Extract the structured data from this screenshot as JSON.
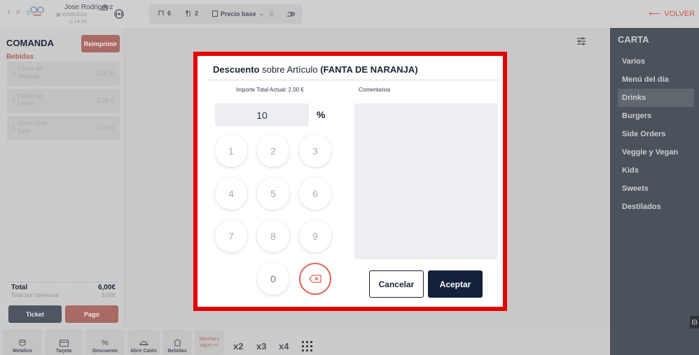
{
  "colors": {
    "accent": "#c65a4a",
    "modal_frame": "#e40000",
    "primary_dark": "#15203a",
    "sidebar_bg": "#4c525b"
  },
  "header": {
    "logo_text": "T·P·S·I",
    "user_name": "Jose Rodriguez",
    "date": "01/08/2025",
    "time": "14:24",
    "table_count": "6",
    "diners_count": "2",
    "price_mode": "Precio base",
    "back_label": "VOLVER"
  },
  "order": {
    "title": "COMANDA",
    "reprint_label": "Reimprimir",
    "category": "Bebidas",
    "items": [
      {
        "qty": "1",
        "name": "Fanta de Naranja",
        "price": "2,00 €"
      },
      {
        "qty": "1",
        "name": "Fanta de Limón",
        "price": "2,00 €"
      },
      {
        "qty": "1",
        "name": "Coca-Cola Zero",
        "price": "2,00 €"
      }
    ],
    "total_label": "Total",
    "total_value": "6,00€",
    "per_diner_label": "Total por comensal",
    "per_diner_value": "3,00€",
    "ticket_label": "Ticket",
    "pay_label": "Pago"
  },
  "toolbar": {
    "cash": "Metalico",
    "card": "Tarjeta",
    "discount": "Descuento",
    "open_drawer": "Abrir Caión",
    "drinks": "Bebidas",
    "march_line1": "Marcha y",
    "march_line2": "sigue >>",
    "x2": "x2",
    "x3": "x3",
    "x4": "x4"
  },
  "menu": {
    "title": "CARTA",
    "items": [
      "Varios",
      "Menú del día",
      "Drinks",
      "Burgers",
      "Side Orders",
      "Veggie y Vegan",
      "Kids",
      "Sweets",
      "Destilados"
    ],
    "active": "Drinks"
  },
  "modal": {
    "title_bold": "Descuento",
    "title_middle": "sobre Artículo",
    "title_item": "(FANTA DE NARANJA)",
    "current_total": "Importe Total Actual: 2,00 €",
    "comments_label": "Comentarios",
    "value": "10",
    "unit": "%",
    "keys": [
      "1",
      "2",
      "3",
      "4",
      "5",
      "6",
      "7",
      "8",
      "9",
      "0"
    ],
    "cancel_label": "Cancelar",
    "accept_label": "Aceptar"
  }
}
